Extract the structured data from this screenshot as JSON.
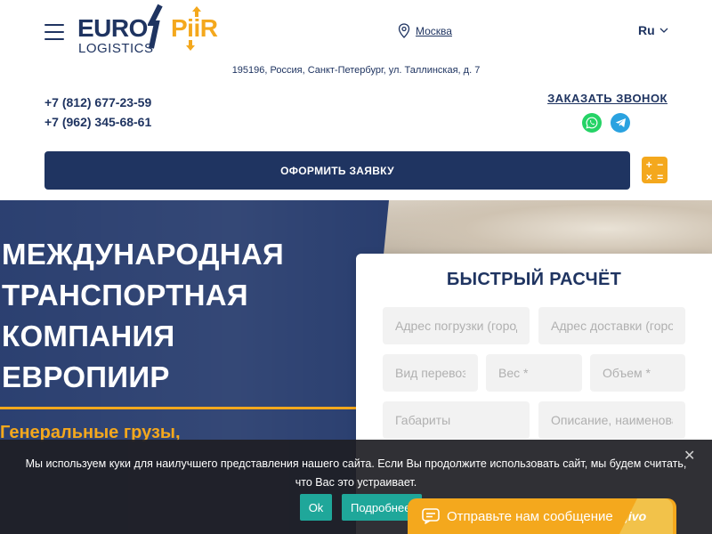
{
  "header": {
    "logo": {
      "euro": "EURO",
      "piir": "PiiR",
      "logistics": "LOGISTICS"
    },
    "city": "Москва",
    "language": "Ru",
    "address": "195196, Россия, Санкт-Петербург, ул. Таллинская, д. 7",
    "phones": [
      "+7 (812) 677-23-59",
      "+7 (962) 345-68-61"
    ],
    "callback_label": "ЗАКАЗАТЬ ЗВОНОК",
    "order_label": "ОФОРМИТЬ ЗАЯВКУ",
    "calc_symbols": [
      "+",
      "−",
      "×",
      "="
    ]
  },
  "hero": {
    "title": "МЕЖДУНАРОДНАЯ ТРАНСПОРТНАЯ КОМПАНИЯ ЕВРОПИИР",
    "subtitle": "Генеральные грузы,"
  },
  "quick_calc": {
    "title": "БЫСТРЫЙ РАСЧЁТ",
    "fields": {
      "pickup": "Адрес погрузки (город",
      "delivery": "Адрес доставки (город",
      "transport": "Вид перевозки",
      "weight": "Вес *",
      "volume": "Объем *",
      "dimensions": "Габариты",
      "description": "Описание, наименование"
    }
  },
  "cookie": {
    "text": "Мы используем куки для наилучшего представления нашего сайта. Если Вы продолжите использовать сайт, мы будем считать, что Вас это устраивает.",
    "ok_label": "Ok",
    "more_label": "Подробнее",
    "close_symbol": "✕"
  },
  "chat": {
    "label": "Отправьте нам сообщение",
    "brand": "jivo"
  },
  "colors": {
    "navy": "#1f3461",
    "accent": "#f4a81d",
    "whatsapp": "#25d366",
    "telegram": "#2aa2e0",
    "cookie_button": "#1fa79a"
  }
}
